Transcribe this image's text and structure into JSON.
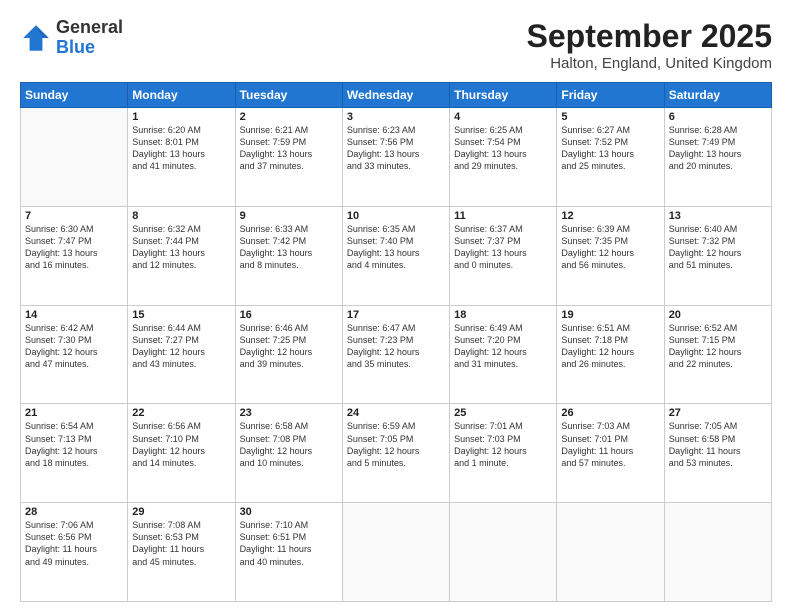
{
  "header": {
    "logo_line1": "General",
    "logo_line2": "Blue",
    "month": "September 2025",
    "location": "Halton, England, United Kingdom"
  },
  "weekdays": [
    "Sunday",
    "Monday",
    "Tuesday",
    "Wednesday",
    "Thursday",
    "Friday",
    "Saturday"
  ],
  "weeks": [
    [
      {
        "day": "",
        "info": ""
      },
      {
        "day": "1",
        "info": "Sunrise: 6:20 AM\nSunset: 8:01 PM\nDaylight: 13 hours\nand 41 minutes."
      },
      {
        "day": "2",
        "info": "Sunrise: 6:21 AM\nSunset: 7:59 PM\nDaylight: 13 hours\nand 37 minutes."
      },
      {
        "day": "3",
        "info": "Sunrise: 6:23 AM\nSunset: 7:56 PM\nDaylight: 13 hours\nand 33 minutes."
      },
      {
        "day": "4",
        "info": "Sunrise: 6:25 AM\nSunset: 7:54 PM\nDaylight: 13 hours\nand 29 minutes."
      },
      {
        "day": "5",
        "info": "Sunrise: 6:27 AM\nSunset: 7:52 PM\nDaylight: 13 hours\nand 25 minutes."
      },
      {
        "day": "6",
        "info": "Sunrise: 6:28 AM\nSunset: 7:49 PM\nDaylight: 13 hours\nand 20 minutes."
      }
    ],
    [
      {
        "day": "7",
        "info": "Sunrise: 6:30 AM\nSunset: 7:47 PM\nDaylight: 13 hours\nand 16 minutes."
      },
      {
        "day": "8",
        "info": "Sunrise: 6:32 AM\nSunset: 7:44 PM\nDaylight: 13 hours\nand 12 minutes."
      },
      {
        "day": "9",
        "info": "Sunrise: 6:33 AM\nSunset: 7:42 PM\nDaylight: 13 hours\nand 8 minutes."
      },
      {
        "day": "10",
        "info": "Sunrise: 6:35 AM\nSunset: 7:40 PM\nDaylight: 13 hours\nand 4 minutes."
      },
      {
        "day": "11",
        "info": "Sunrise: 6:37 AM\nSunset: 7:37 PM\nDaylight: 13 hours\nand 0 minutes."
      },
      {
        "day": "12",
        "info": "Sunrise: 6:39 AM\nSunset: 7:35 PM\nDaylight: 12 hours\nand 56 minutes."
      },
      {
        "day": "13",
        "info": "Sunrise: 6:40 AM\nSunset: 7:32 PM\nDaylight: 12 hours\nand 51 minutes."
      }
    ],
    [
      {
        "day": "14",
        "info": "Sunrise: 6:42 AM\nSunset: 7:30 PM\nDaylight: 12 hours\nand 47 minutes."
      },
      {
        "day": "15",
        "info": "Sunrise: 6:44 AM\nSunset: 7:27 PM\nDaylight: 12 hours\nand 43 minutes."
      },
      {
        "day": "16",
        "info": "Sunrise: 6:46 AM\nSunset: 7:25 PM\nDaylight: 12 hours\nand 39 minutes."
      },
      {
        "day": "17",
        "info": "Sunrise: 6:47 AM\nSunset: 7:23 PM\nDaylight: 12 hours\nand 35 minutes."
      },
      {
        "day": "18",
        "info": "Sunrise: 6:49 AM\nSunset: 7:20 PM\nDaylight: 12 hours\nand 31 minutes."
      },
      {
        "day": "19",
        "info": "Sunrise: 6:51 AM\nSunset: 7:18 PM\nDaylight: 12 hours\nand 26 minutes."
      },
      {
        "day": "20",
        "info": "Sunrise: 6:52 AM\nSunset: 7:15 PM\nDaylight: 12 hours\nand 22 minutes."
      }
    ],
    [
      {
        "day": "21",
        "info": "Sunrise: 6:54 AM\nSunset: 7:13 PM\nDaylight: 12 hours\nand 18 minutes."
      },
      {
        "day": "22",
        "info": "Sunrise: 6:56 AM\nSunset: 7:10 PM\nDaylight: 12 hours\nand 14 minutes."
      },
      {
        "day": "23",
        "info": "Sunrise: 6:58 AM\nSunset: 7:08 PM\nDaylight: 12 hours\nand 10 minutes."
      },
      {
        "day": "24",
        "info": "Sunrise: 6:59 AM\nSunset: 7:05 PM\nDaylight: 12 hours\nand 5 minutes."
      },
      {
        "day": "25",
        "info": "Sunrise: 7:01 AM\nSunset: 7:03 PM\nDaylight: 12 hours\nand 1 minute."
      },
      {
        "day": "26",
        "info": "Sunrise: 7:03 AM\nSunset: 7:01 PM\nDaylight: 11 hours\nand 57 minutes."
      },
      {
        "day": "27",
        "info": "Sunrise: 7:05 AM\nSunset: 6:58 PM\nDaylight: 11 hours\nand 53 minutes."
      }
    ],
    [
      {
        "day": "28",
        "info": "Sunrise: 7:06 AM\nSunset: 6:56 PM\nDaylight: 11 hours\nand 49 minutes."
      },
      {
        "day": "29",
        "info": "Sunrise: 7:08 AM\nSunset: 6:53 PM\nDaylight: 11 hours\nand 45 minutes."
      },
      {
        "day": "30",
        "info": "Sunrise: 7:10 AM\nSunset: 6:51 PM\nDaylight: 11 hours\nand 40 minutes."
      },
      {
        "day": "",
        "info": ""
      },
      {
        "day": "",
        "info": ""
      },
      {
        "day": "",
        "info": ""
      },
      {
        "day": "",
        "info": ""
      }
    ]
  ]
}
